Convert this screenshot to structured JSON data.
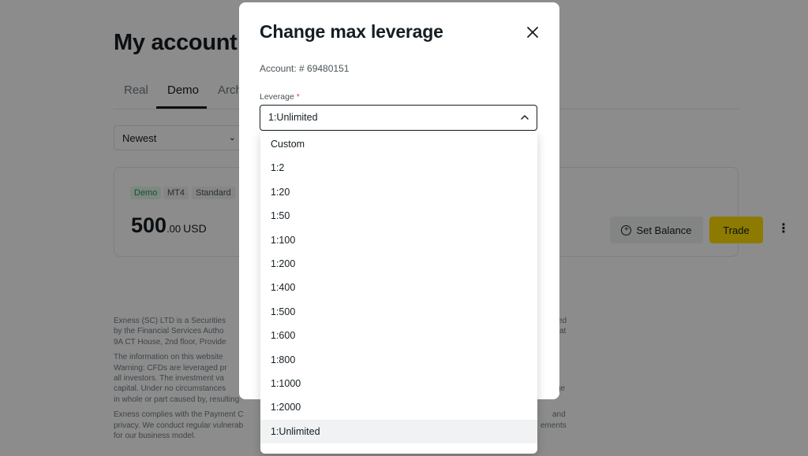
{
  "page": {
    "title": "My account",
    "tabs": [
      "Real",
      "Demo",
      "Arch"
    ],
    "active_tab": "Demo",
    "sort": {
      "value": "Newest"
    },
    "account_card": {
      "badges": [
        "Demo",
        "MT4",
        "Standard"
      ],
      "balance_int": "500",
      "balance_dec": ".00",
      "currency": "USD",
      "set_balance_label": "Set Balance",
      "trade_label": "Trade"
    },
    "footer": {
      "p1": "Exness (SC) LTD is a Securities",
      "p1_l2": "by the Financial Services Autho",
      "p1_l3": "9A CT House, 2nd floor, Provide",
      "p1_right": "ed",
      "p1_right_l2": "at",
      "p2": "The information on this website",
      "p2_l2": "Warning: CFDs are leveraged pr",
      "p2_l3": "all investors. The investment va",
      "p2_l4": "capital. Under no circumstances",
      "p2_l5": "in whole or part caused by, resulting",
      "p2_right_l4": "ge",
      "p3": "Exness complies with the Payment C",
      "p3_l2": "privacy. We conduct regular vulnerab",
      "p3_l3": "for our business model.",
      "p3_right": "and",
      "p3_right_l2": "ements"
    }
  },
  "modal": {
    "title": "Change max leverage",
    "account_label": "Account: # 69480151",
    "leverage_label": "Leverage",
    "required_mark": "*",
    "selected_value": "1:Unlimited",
    "options": [
      "Custom",
      "1:2",
      "1:20",
      "1:50",
      "1:100",
      "1:200",
      "1:400",
      "1:500",
      "1:600",
      "1:800",
      "1:1000",
      "1:2000",
      "1:Unlimited"
    ]
  },
  "colors": {
    "accent_yellow": "#ffde02",
    "demo_green": "#1c9d57",
    "required_red": "#e0433f"
  }
}
